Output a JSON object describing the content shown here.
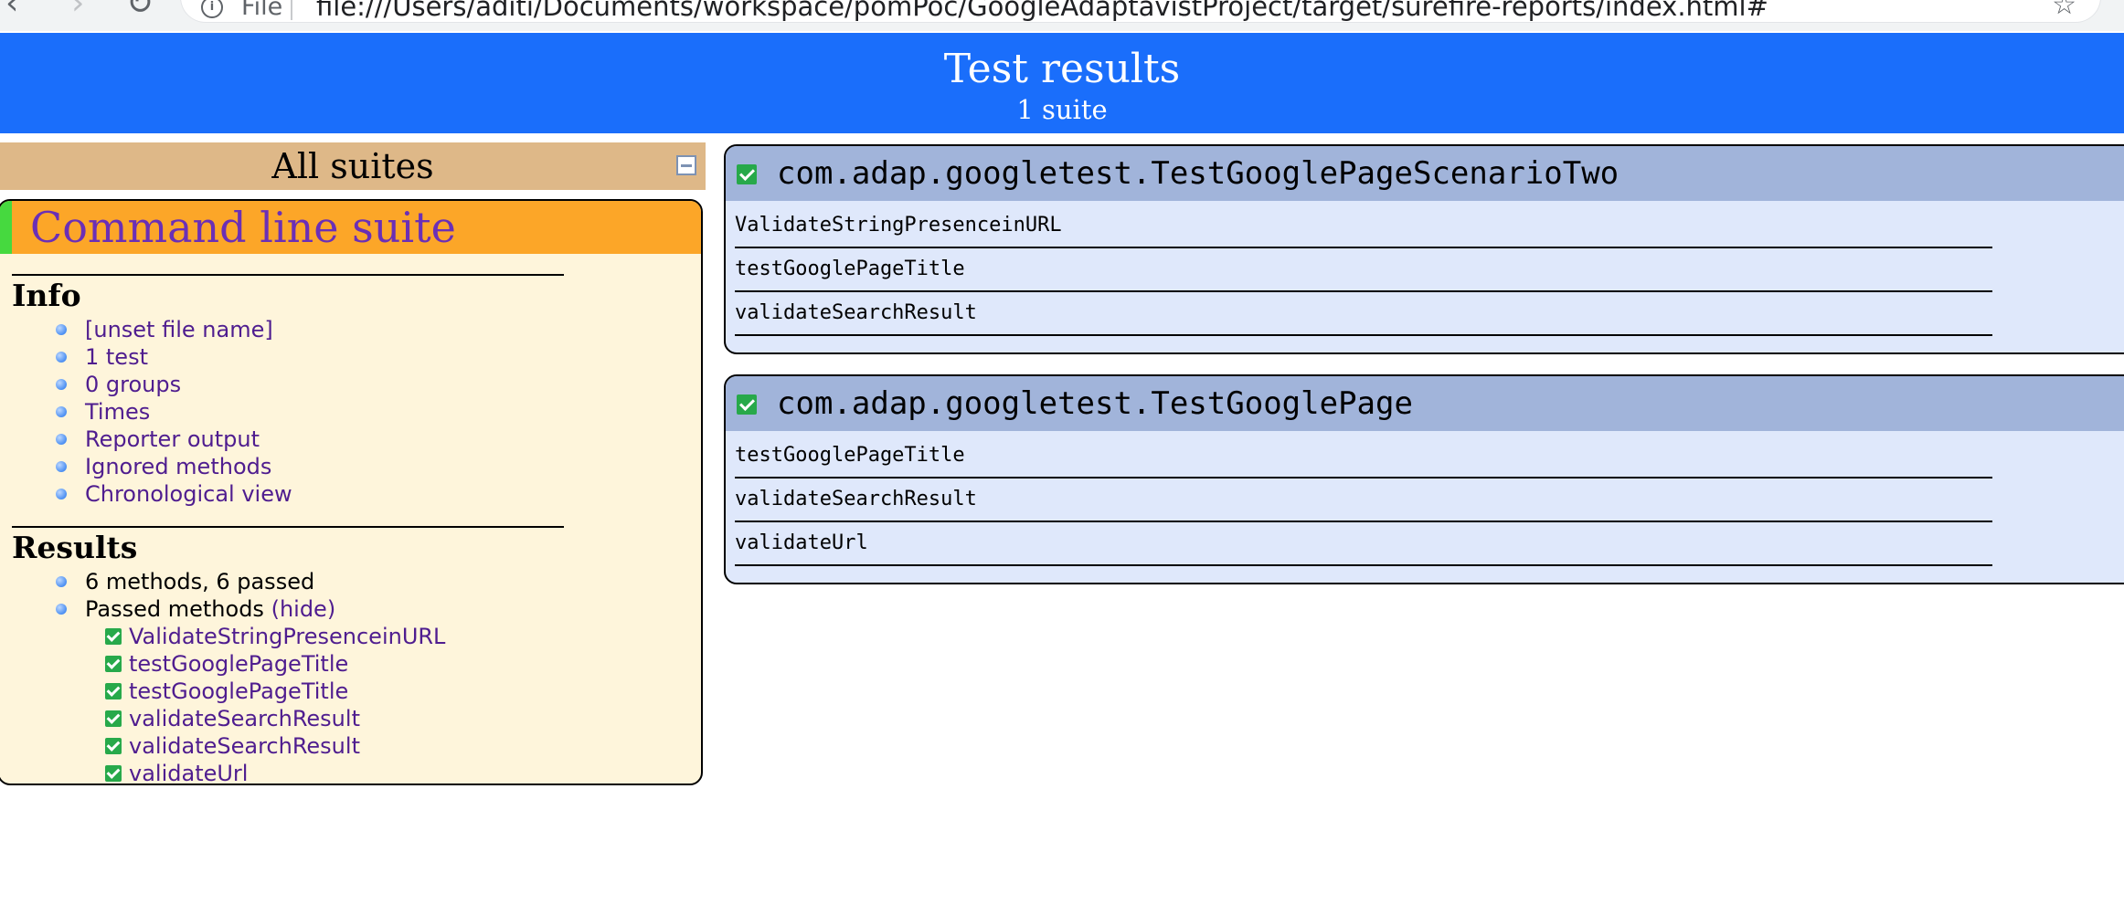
{
  "browser": {
    "chip_label": "File",
    "url": "file:///Users/aditi/Documents/workspace/pomPoc/GoogleAdaptavistProject/target/surefire-reports/index.html#"
  },
  "banner": {
    "title": "Test results",
    "subtitle": "1 suite"
  },
  "navigator": {
    "header": "All suites",
    "suite": {
      "name": "Command line suite",
      "info_title": "Info",
      "info_items": [
        "[unset file name]",
        "1 test",
        "0 groups",
        "Times",
        "Reporter output",
        "Ignored methods",
        "Chronological view"
      ],
      "results_title": "Results",
      "methods_summary": "6 methods, 6 passed",
      "passed_methods_label": "Passed methods",
      "hide_link": "(hide)",
      "passed_methods": [
        "ValidateStringPresenceinURL",
        "testGooglePageTitle",
        "testGooglePageTitle",
        "validateSearchResult",
        "validateSearchResult",
        "validateUrl"
      ]
    }
  },
  "classes": [
    {
      "name": "com.adap.googletest.TestGooglePageScenarioTwo",
      "methods": [
        "ValidateStringPresenceinURL",
        "testGooglePageTitle",
        "validateSearchResult"
      ]
    },
    {
      "name": "com.adap.googletest.TestGooglePage",
      "methods": [
        "testGooglePageTitle",
        "validateSearchResult",
        "validateUrl"
      ]
    }
  ],
  "colors": {
    "banner": "#1a6efb",
    "suite_header": "#fca628",
    "nav_header": "#deb888",
    "suite_panel": "#fef5db",
    "class_header": "#a1b4da",
    "class_panel": "#dfe8fb",
    "link": "#4f1d8f",
    "passed_check": "#27a94a"
  },
  "icons": {
    "passed": "check-icon",
    "collapse": "collapse-icon",
    "bullet": "bullet-icon"
  }
}
